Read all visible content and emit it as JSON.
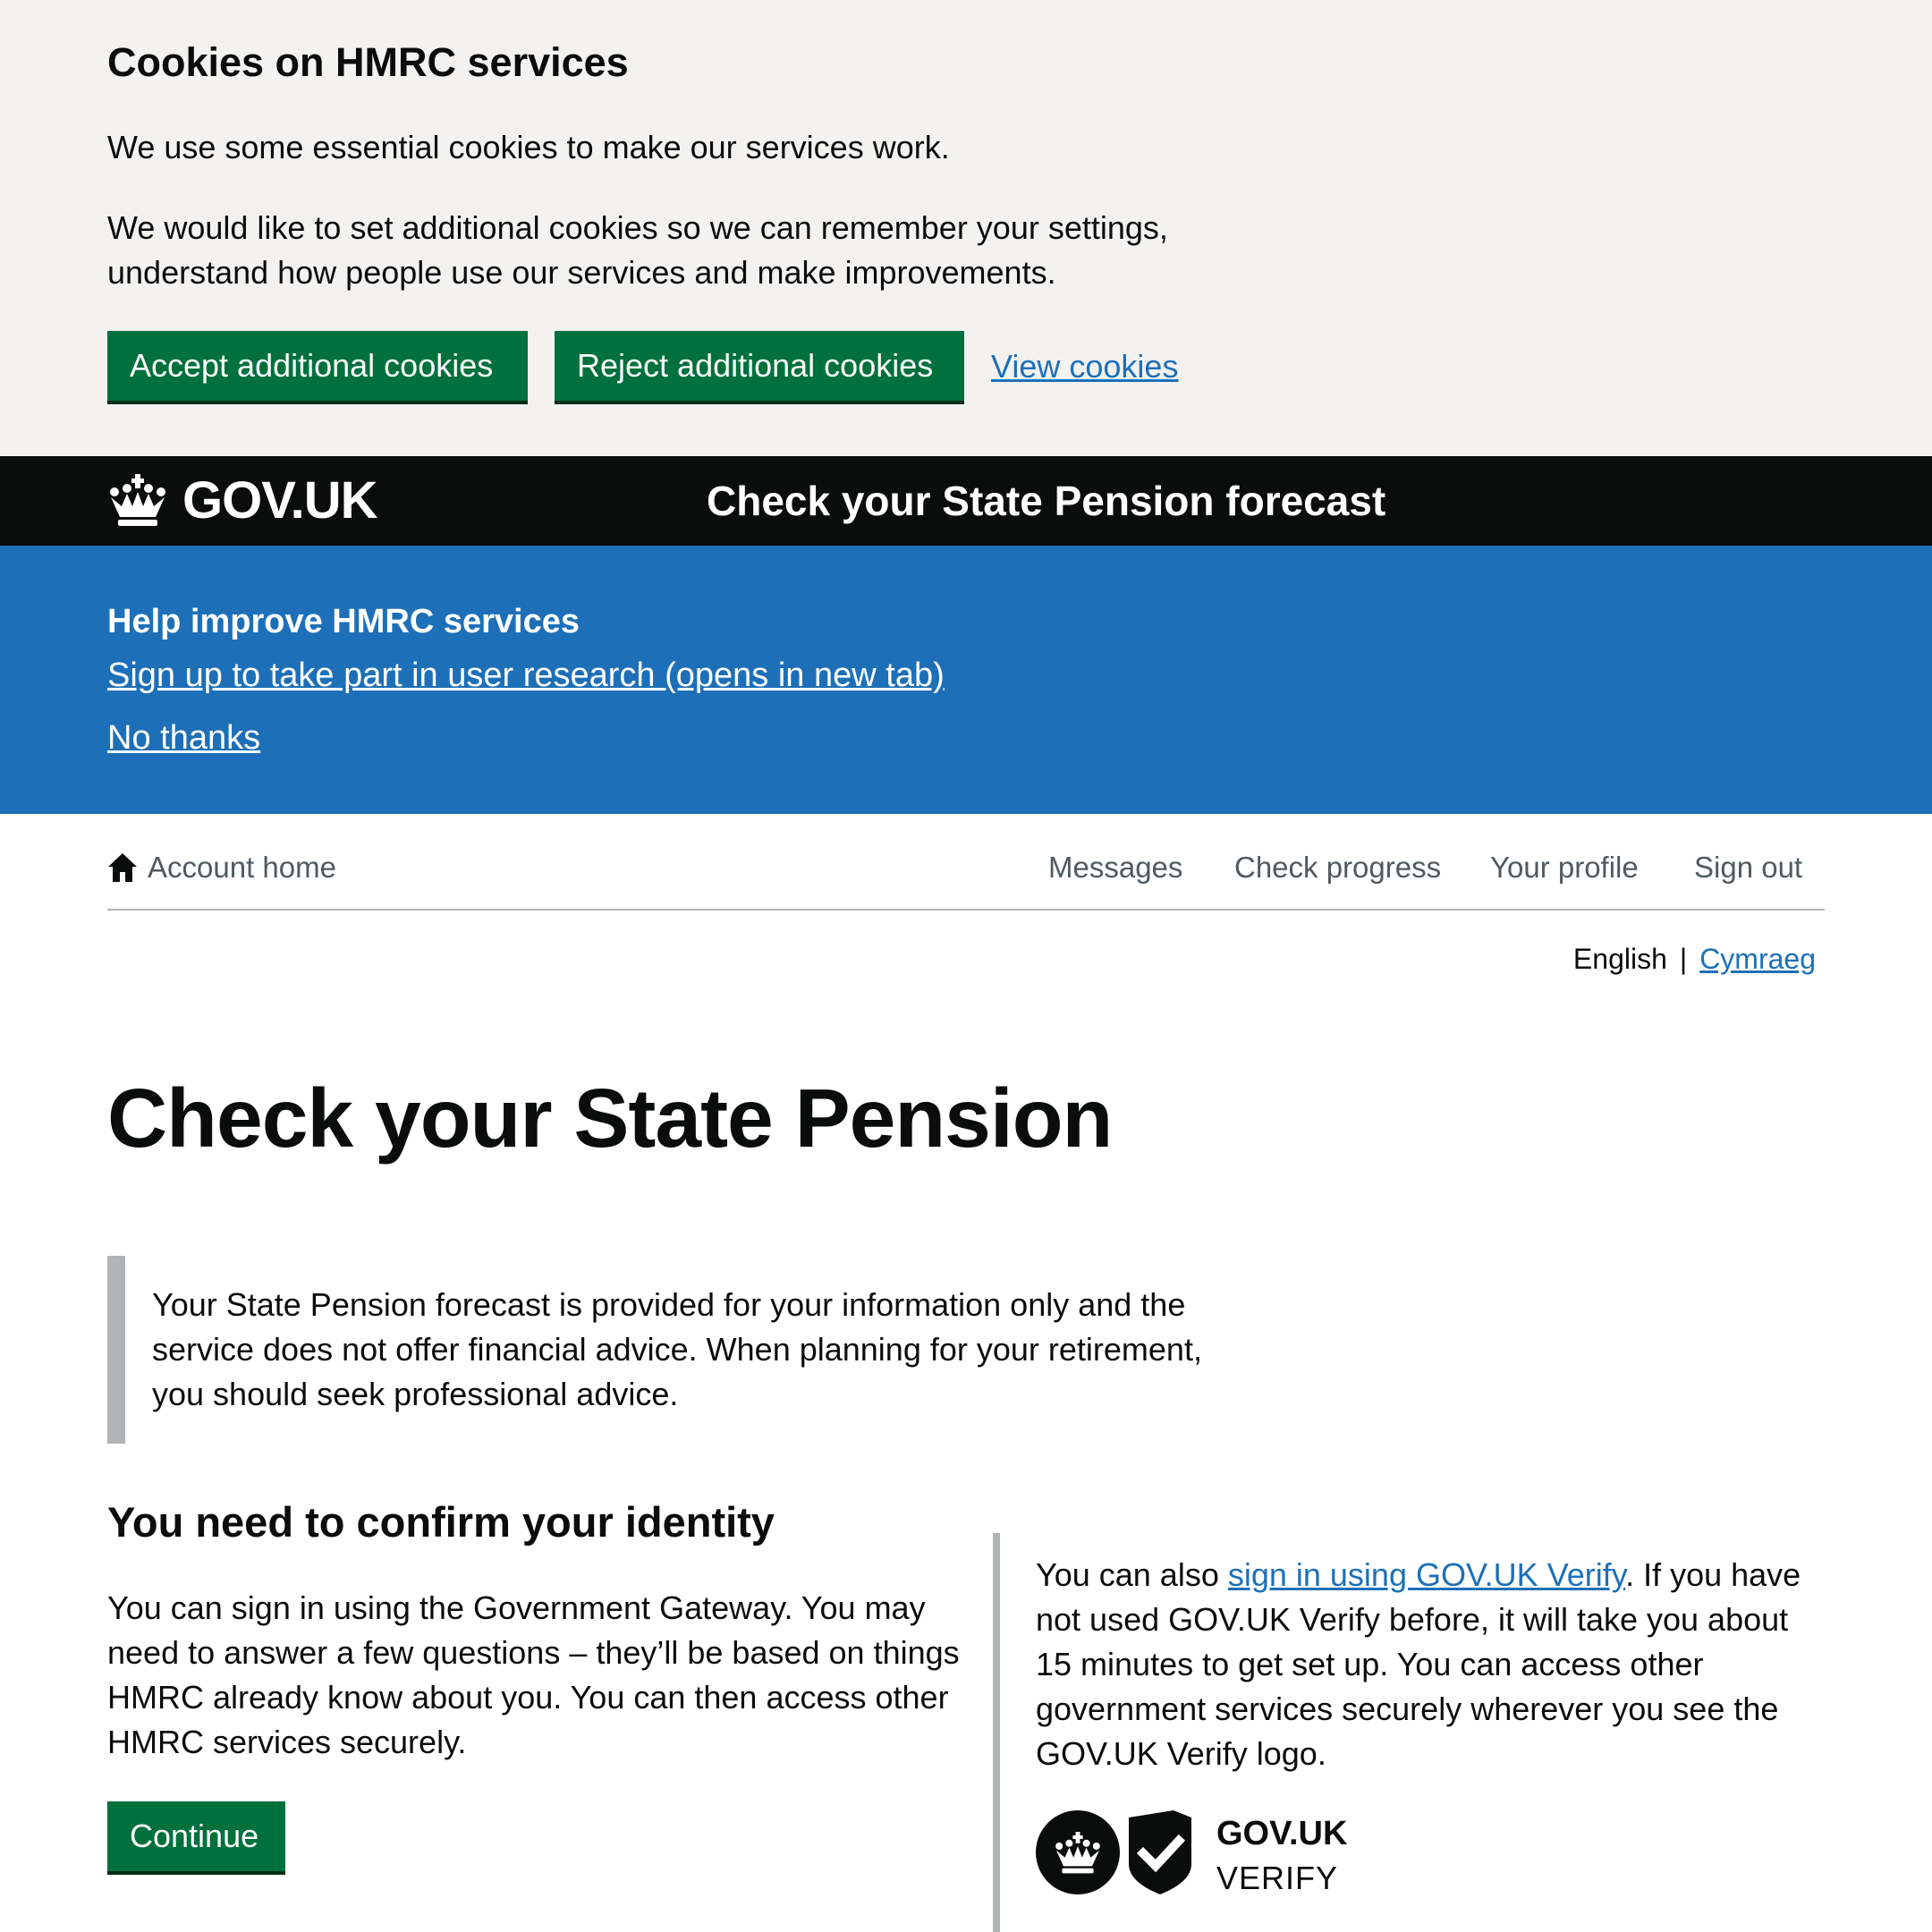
{
  "cookie_banner": {
    "title": "Cookies on HMRC services",
    "paragraph_1": "We use some essential cookies to make our services work.",
    "paragraph_2": "We would like to set additional cookies so we can remember your settings, understand how people use our services and make improvements.",
    "accept_label": "Accept additional cookies",
    "reject_label": "Reject additional cookies",
    "view_label": "View cookies"
  },
  "header": {
    "logo_text": "GOV.UK",
    "service_name": "Check your State Pension forecast"
  },
  "research_banner": {
    "title": "Help improve HMRC services",
    "signup_link": "Sign up to take part in user research (opens in new tab)",
    "no_thanks": "No thanks"
  },
  "account_nav": {
    "home_label": "Account home",
    "items": [
      {
        "label": "Messages"
      },
      {
        "label": "Check progress"
      },
      {
        "label": "Your profile"
      },
      {
        "label": "Sign out"
      }
    ]
  },
  "language": {
    "current": "English",
    "separator": "|",
    "other": "Cymraeg"
  },
  "main": {
    "title": "Check your State Pension",
    "inset_text": "Your State Pension forecast is provided for your information only and the service does not offer financial advice. When planning for your retirement, you should seek professional advice.",
    "confirm_heading": "You need to confirm your identity",
    "confirm_text": "You can sign in using the Government Gateway. You may need to answer a few questions – they’ll be based on things HMRC already know about you. You can then access other HMRC services securely.",
    "continue_label": "Continue",
    "verify_before": "You can also ",
    "verify_link": "sign in using GOV.UK Verify",
    "verify_after": ". If you have not used GOV.UK Verify before, it will take you about 15 minutes to get set up. You can access other government services securely wherever you see the GOV.UK Verify logo.",
    "verify_logo_line1": "GOV.UK",
    "verify_logo_line2": "VERIFY"
  },
  "colors": {
    "button_green": "#00703c",
    "link_blue": "#1d70b8",
    "header_black": "#0b0c0c",
    "banner_grey": "#f3f2f1",
    "border_grey": "#b1b4b6"
  },
  "icons": [
    "crown-icon",
    "home-icon",
    "verify-crown-icon",
    "verify-shield-check-icon"
  ]
}
